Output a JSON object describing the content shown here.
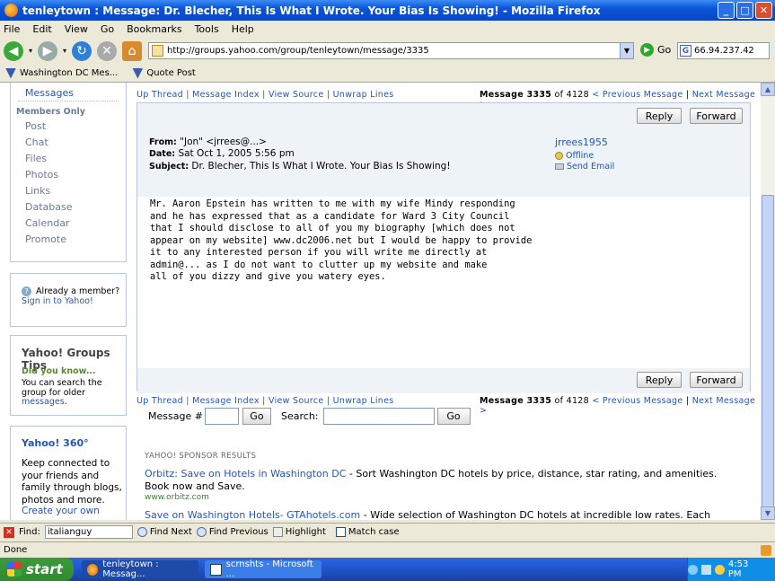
{
  "window": {
    "title": "tenleytown : Message: Dr. Blecher, This Is What I Wrote. Your Bias Is Showing! - Mozilla Firefox"
  },
  "menu": [
    "File",
    "Edit",
    "View",
    "Go",
    "Bookmarks",
    "Tools",
    "Help"
  ],
  "nav": {
    "url": "http://groups.yahoo.com/group/tenleytown/message/3335",
    "go_label": "Go",
    "search_value": "66.94.237.42"
  },
  "bookmarks": [
    "Washington DC Mes...",
    "Quote Post"
  ],
  "sidebar": {
    "top_link": "Messages",
    "members_only": "Members Only",
    "links": [
      "Post",
      "Chat",
      "Files",
      "Photos",
      "Links",
      "Database",
      "Calendar",
      "Promote"
    ],
    "already_member": "Already a member?",
    "sign_in": "Sign in to Yahoo!",
    "tips_title": "Yahoo! Groups Tips",
    "did_you_know": "Did you know...",
    "tip_text": "You can search the group for older",
    "tip_link": "messages",
    "y360_title": "Yahoo! 360°",
    "y360_text": "Keep connected to your friends and family through blogs, photos and more.",
    "y360_link": "Create your own"
  },
  "thread_nav": {
    "up_thread": "Up Thread",
    "message_index": "Message Index",
    "view_source": "View Source",
    "unwrap_lines": "Unwrap Lines",
    "message_label": "Message 3335",
    "of_total": "of 4128",
    "previous": "< Previous Message",
    "next": "Next Message >"
  },
  "message": {
    "reply": "Reply",
    "forward": "Forward",
    "from_label": "From:",
    "from": "\"Jon\" <jrrees@...>",
    "date_label": "Date:",
    "date": "Sat Oct 1, 2005  5:56 pm",
    "subject_label": "Subject:",
    "subject": "Dr. Blecher, This Is What I Wrote. Your Bias Is Showing!",
    "author": "jrrees1955",
    "status": "Offline",
    "send_email": "Send Email",
    "body": "Mr. Aaron Epstein has written to me with my wife Mindy responding\nand he has expressed that as a candidate for Ward 3 City Council\nthat I should disclose to all of you my biography [which does not\nappear on my website] www.dc2006.net but I would be happy to provide\nit to any interested person if you will write me directly at\nadmin@... as I do not want to clutter up my website and make\nall of you dizzy and give you watery eyes."
  },
  "form": {
    "message_label": "Message #",
    "go": "Go",
    "search_label": "Search:",
    "go2": "Go"
  },
  "sponsor": {
    "heading": "YAHOO! SPONSOR RESULTS",
    "ad1_link": "Orbitz: Save on Hotels in Washington DC",
    "ad1_text": " - Sort Washington DC hotels by price, distance, star rating, and amenities. Book now and Save.",
    "ad1_url": "www.orbitz.com",
    "ad2_link": "Save on Washington Hotels- GTAhotels.com",
    "ad2_text": " - Wide selection of Washington DC hotels at incredible low rates. Each hotel with"
  },
  "findbar": {
    "label": "Find:",
    "value": "italianguy",
    "next": "Find Next",
    "previous": "Find Previous",
    "highlight": "Highlight",
    "match_case": "Match case"
  },
  "status": "Done",
  "taskbar": {
    "start": "start",
    "task1": "tenleytown : Messag...",
    "task2": "scrnshts - Microsoft ...",
    "clock": "4:53 PM"
  }
}
